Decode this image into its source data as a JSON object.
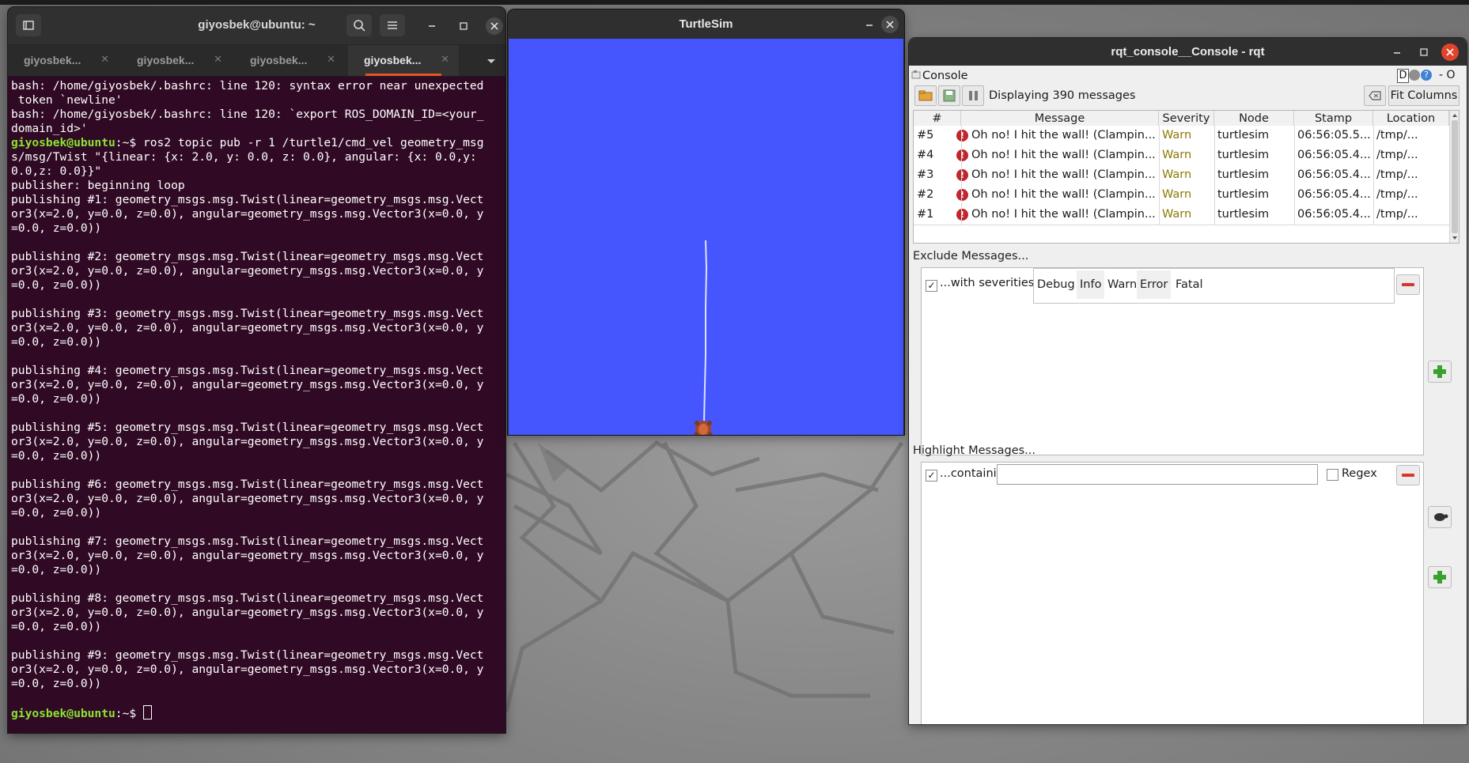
{
  "terminal": {
    "title": "giyosbek@ubuntu: ~",
    "tabs": [
      {
        "label": "giyosbek..."
      },
      {
        "label": "giyosbek..."
      },
      {
        "label": "giyosbek..."
      },
      {
        "label": "giyosbek..."
      }
    ],
    "lines": [
      "bash: /home/giyosbek/.bashrc: line 120: syntax error near unexpected",
      " token `newline'",
      "bash: /home/giyosbek/.bashrc: line 120: `export ROS_DOMAIN_ID=<your_",
      "domain_id>'",
      "s/msg/Twist \"{linear: {x: 2.0, y: 0.0, z: 0.0}, angular: {x: 0.0,y:",
      "0.0,z: 0.0}}\"",
      "publisher: beginning loop",
      "publishing #1: geometry_msgs.msg.Twist(linear=geometry_msgs.msg.Vect",
      "or3(x=2.0, y=0.0, z=0.0), angular=geometry_msgs.msg.Vector3(x=0.0, y",
      "=0.0, z=0.0))",
      "",
      "publishing #2: geometry_msgs.msg.Twist(linear=geometry_msgs.msg.Vect",
      "or3(x=2.0, y=0.0, z=0.0), angular=geometry_msgs.msg.Vector3(x=0.0, y",
      "=0.0, z=0.0))",
      "",
      "publishing #3: geometry_msgs.msg.Twist(linear=geometry_msgs.msg.Vect",
      "or3(x=2.0, y=0.0, z=0.0), angular=geometry_msgs.msg.Vector3(x=0.0, y",
      "=0.0, z=0.0))",
      "",
      "publishing #4: geometry_msgs.msg.Twist(linear=geometry_msgs.msg.Vect",
      "or3(x=2.0, y=0.0, z=0.0), angular=geometry_msgs.msg.Vector3(x=0.0, y",
      "=0.0, z=0.0))",
      "",
      "publishing #5: geometry_msgs.msg.Twist(linear=geometry_msgs.msg.Vect",
      "or3(x=2.0, y=0.0, z=0.0), angular=geometry_msgs.msg.Vector3(x=0.0, y",
      "=0.0, z=0.0))",
      "",
      "publishing #6: geometry_msgs.msg.Twist(linear=geometry_msgs.msg.Vect",
      "or3(x=2.0, y=0.0, z=0.0), angular=geometry_msgs.msg.Vector3(x=0.0, y",
      "=0.0, z=0.0))",
      "",
      "publishing #7: geometry_msgs.msg.Twist(linear=geometry_msgs.msg.Vect",
      "or3(x=2.0, y=0.0, z=0.0), angular=geometry_msgs.msg.Vector3(x=0.0, y",
      "=0.0, z=0.0))",
      "",
      "publishing #8: geometry_msgs.msg.Twist(linear=geometry_msgs.msg.Vect",
      "or3(x=2.0, y=0.0, z=0.0), angular=geometry_msgs.msg.Vector3(x=0.0, y",
      "=0.0, z=0.0))",
      "",
      "publishing #9: geometry_msgs.msg.Twist(linear=geometry_msgs.msg.Vect",
      "or3(x=2.0, y=0.0, z=0.0), angular=geometry_msgs.msg.Vector3(x=0.0, y",
      "=0.0, z=0.0))",
      ""
    ],
    "prompt": "giyosbek@ubuntu",
    "prompt_suffix": ":~$ ",
    "command_line": "ros2 topic pub -r 1 /turtle1/cmd_vel geometry_msg",
    "command_line_index": 4
  },
  "turtlesim": {
    "title": "TurtleSim",
    "background_color": "#4556ff"
  },
  "rqt": {
    "title": "rqt_console__Console - rqt",
    "plugin_label": "Console",
    "plugin_corner_label": "D",
    "plugin_corner_extra": "- O",
    "displaying": "Displaying 390 messages",
    "fit_columns": "Fit Columns",
    "columns": [
      "#",
      "Message",
      "Severity",
      "Node",
      "Stamp",
      "Location"
    ],
    "rows": [
      {
        "num": "#5",
        "message": "Oh no! I hit the wall! (Clampin...",
        "severity": "Warn",
        "node": "turtlesim",
        "stamp": "06:56:05.5...",
        "location": "/tmp/..."
      },
      {
        "num": "#4",
        "message": "Oh no! I hit the wall! (Clampin...",
        "severity": "Warn",
        "node": "turtlesim",
        "stamp": "06:56:05.4...",
        "location": "/tmp/..."
      },
      {
        "num": "#3",
        "message": "Oh no! I hit the wall! (Clampin...",
        "severity": "Warn",
        "node": "turtlesim",
        "stamp": "06:56:05.4...",
        "location": "/tmp/..."
      },
      {
        "num": "#2",
        "message": "Oh no! I hit the wall! (Clampin...",
        "severity": "Warn",
        "node": "turtlesim",
        "stamp": "06:56:05.4...",
        "location": "/tmp/..."
      },
      {
        "num": "#1",
        "message": "Oh no! I hit the wall! (Clampin...",
        "severity": "Warn",
        "node": "turtlesim",
        "stamp": "06:56:05.4...",
        "location": "/tmp/..."
      }
    ],
    "exclude_label": "Exclude Messages...",
    "with_severities": "...with severities:",
    "severities": [
      "Debug",
      "Info",
      "Warn",
      "Error",
      "Fatal"
    ],
    "highlight_label": "Highlight Messages...",
    "containing": "...containing:",
    "containing_value": "",
    "regex": "Regex",
    "accent_remove": "#d9342b",
    "accent_add": "#3aa12f"
  }
}
